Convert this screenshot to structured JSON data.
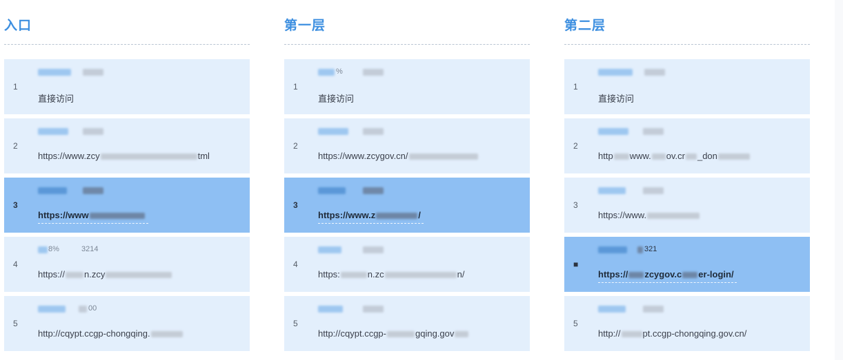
{
  "columns": [
    {
      "title": "入口",
      "rows": [
        {
          "rank": "1",
          "metric_pct": "",
          "metric_value": "",
          "url_parts": [
            "直接访问"
          ]
        },
        {
          "rank": "2",
          "metric_pct": "",
          "metric_value": "",
          "url_parts": [
            "https://www.zcy",
            "tml"
          ]
        },
        {
          "rank": "3",
          "metric_pct": "",
          "metric_value": "",
          "url_parts": [
            "https://www",
            ""
          ]
        },
        {
          "rank": "4",
          "metric_pct": "8%",
          "metric_value": "3214",
          "url_parts": [
            "https://",
            "n.zcy",
            ""
          ]
        },
        {
          "rank": "5",
          "metric_pct": "",
          "metric_value": "00",
          "url_parts": [
            "http://cqypt.ccgp-chongqing.",
            ""
          ]
        }
      ]
    },
    {
      "title": "第一层",
      "rows": [
        {
          "rank": "1",
          "metric_pct": "%",
          "metric_value": "",
          "url_parts": [
            "直接访问"
          ]
        },
        {
          "rank": "2",
          "metric_pct": "",
          "metric_value": "",
          "url_parts": [
            "https://www.zcygov.cn/",
            ""
          ]
        },
        {
          "rank": "3",
          "metric_pct": "",
          "metric_value": "",
          "url_parts": [
            "https://www.z",
            "/"
          ]
        },
        {
          "rank": "4",
          "metric_pct": "",
          "metric_value": "",
          "url_parts": [
            "https:",
            "n.zc",
            "n/"
          ]
        },
        {
          "rank": "5",
          "metric_pct": "",
          "metric_value": "",
          "url_parts": [
            "http://cqypt.ccgp-",
            "gqing.gov",
            ""
          ]
        }
      ]
    },
    {
      "title": "第二层",
      "rows": [
        {
          "rank": "1",
          "metric_pct": "",
          "metric_value": "",
          "url_parts": [
            "直接访问"
          ]
        },
        {
          "rank": "2",
          "metric_pct": "",
          "metric_value": "",
          "url_parts": [
            "http",
            "www.",
            "ov.cr",
            "_don",
            ""
          ]
        },
        {
          "rank": "3",
          "metric_pct": "",
          "metric_value": "",
          "url_parts": [
            "https://www.",
            ""
          ]
        },
        {
          "rank": "■",
          "metric_pct": "",
          "metric_value": "321",
          "url_parts": [
            "https://",
            "zcygov.c",
            "er-login/"
          ]
        },
        {
          "rank": "5",
          "metric_pct": "",
          "metric_value": "",
          "url_parts": [
            "http://",
            "pt.ccgp-chongqing.gov.cn/"
          ]
        }
      ]
    }
  ]
}
